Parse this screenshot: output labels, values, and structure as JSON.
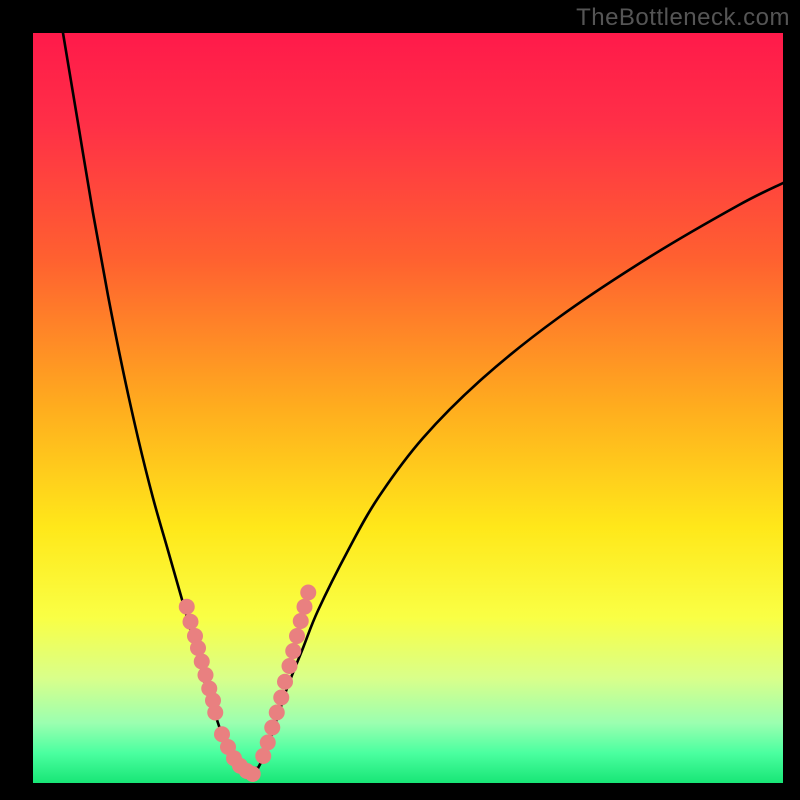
{
  "watermark": "TheBottleneck.com",
  "chart_data": {
    "type": "line",
    "title": "",
    "xlabel": "",
    "ylabel": "",
    "xlim": [
      0,
      100
    ],
    "ylim": [
      0,
      100
    ],
    "gradient_stops": [
      {
        "offset": 0.0,
        "color": "#ff1a4a"
      },
      {
        "offset": 0.12,
        "color": "#ff2f47"
      },
      {
        "offset": 0.3,
        "color": "#ff6030"
      },
      {
        "offset": 0.5,
        "color": "#ffad1e"
      },
      {
        "offset": 0.66,
        "color": "#ffe81a"
      },
      {
        "offset": 0.78,
        "color": "#f9ff45"
      },
      {
        "offset": 0.86,
        "color": "#d9ff8a"
      },
      {
        "offset": 0.92,
        "color": "#9bffb0"
      },
      {
        "offset": 0.96,
        "color": "#4bffa0"
      },
      {
        "offset": 1.0,
        "color": "#18e676"
      }
    ],
    "series": [
      {
        "name": "left-branch",
        "x": [
          4,
          6,
          8,
          10,
          12,
          14,
          16,
          18,
          20,
          22,
          23,
          24,
          25,
          26,
          27
        ],
        "y": [
          100,
          88,
          76,
          65,
          55,
          46,
          38,
          31,
          24,
          17,
          13,
          10,
          7,
          4,
          2
        ]
      },
      {
        "name": "right-branch",
        "x": [
          30,
          31,
          32,
          33,
          34,
          36,
          38,
          42,
          46,
          52,
          60,
          70,
          82,
          94,
          100
        ],
        "y": [
          2,
          4,
          7,
          10,
          13,
          18,
          23,
          31,
          38,
          46,
          54,
          62,
          70,
          77,
          80
        ]
      }
    ],
    "valley_floor": {
      "x": [
        27,
        30
      ],
      "y": [
        2,
        2
      ]
    },
    "markers": {
      "color": "#e98080",
      "radius_px": 8,
      "left_cluster": {
        "x": [
          20.5,
          21.0,
          21.6,
          22.0,
          22.5,
          23.0,
          23.5,
          24.0,
          24.3,
          25.2,
          26.0,
          26.8,
          27.6,
          28.5,
          29.3
        ],
        "y": [
          23.5,
          21.5,
          19.6,
          18.0,
          16.2,
          14.4,
          12.6,
          11.0,
          9.4,
          6.5,
          4.8,
          3.3,
          2.3,
          1.6,
          1.2
        ]
      },
      "right_cluster": {
        "x": [
          30.7,
          31.3,
          31.9,
          32.5,
          33.1,
          33.6,
          34.2,
          34.7,
          35.2,
          35.7,
          36.2,
          36.7
        ],
        "y": [
          3.6,
          5.4,
          7.4,
          9.4,
          11.4,
          13.5,
          15.6,
          17.6,
          19.6,
          21.6,
          23.5,
          25.4
        ]
      }
    }
  }
}
